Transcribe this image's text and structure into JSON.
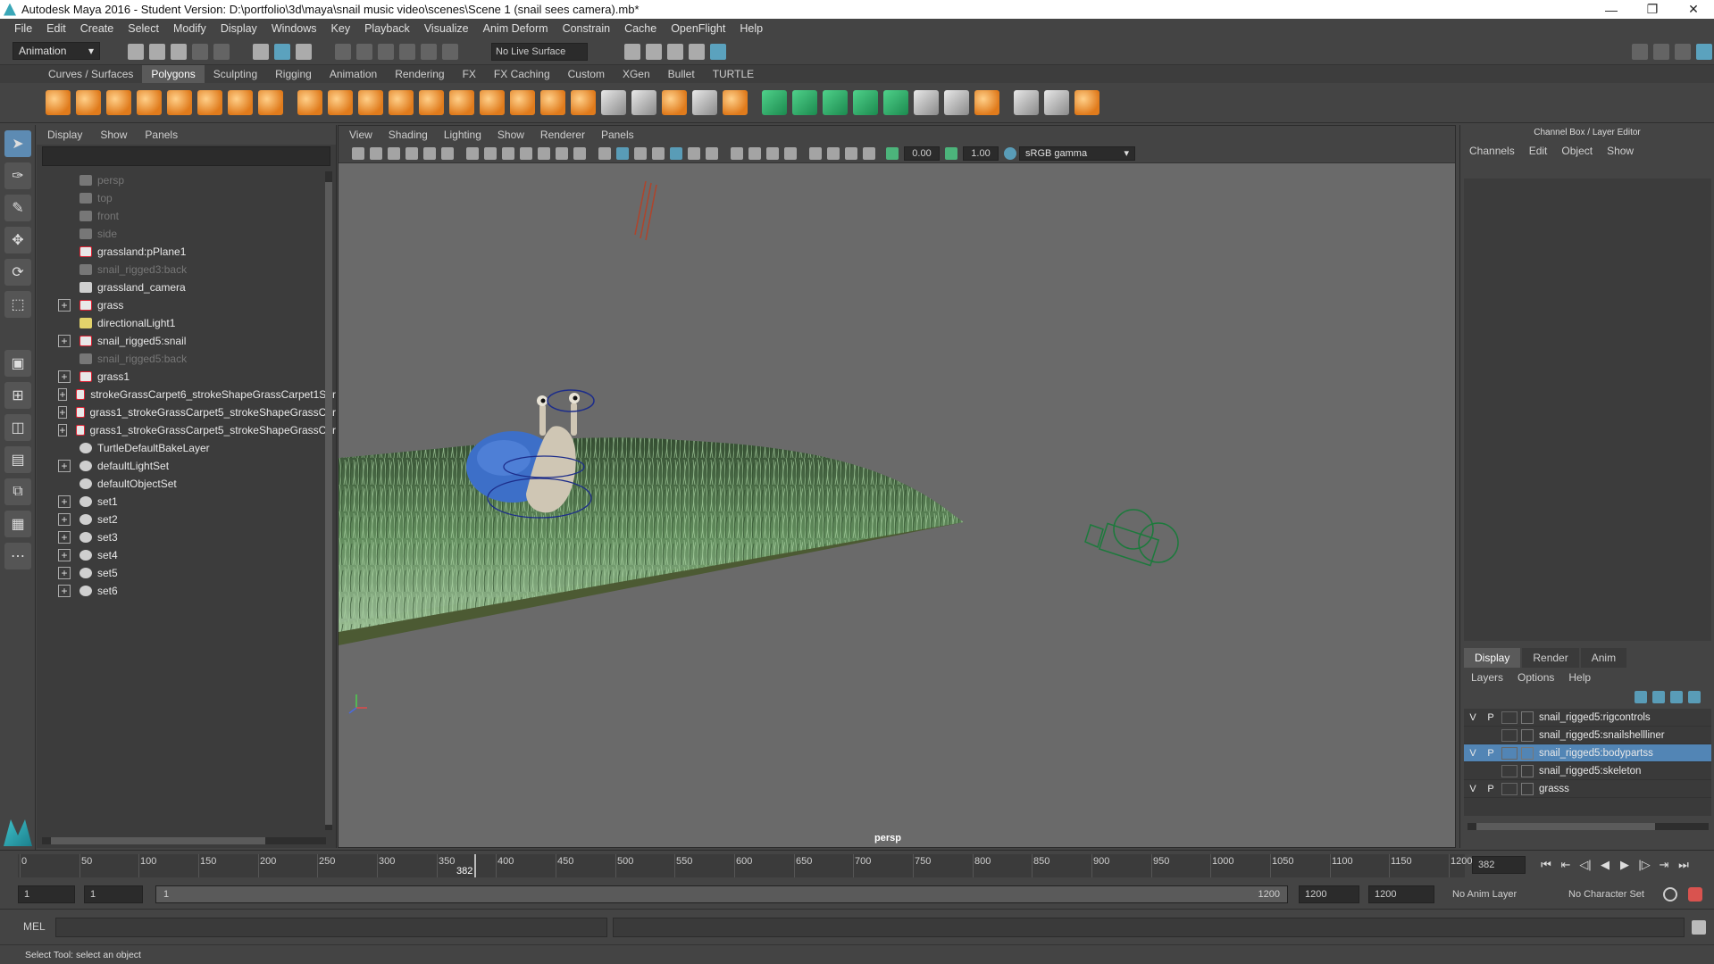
{
  "window": {
    "title": "Autodesk Maya 2016 - Student Version: D:\\portfolio\\3d\\maya\\snail music video\\scenes\\Scene 1 (snail sees camera).mb*",
    "min": "—",
    "max": "❐",
    "close": "✕"
  },
  "menubar": [
    "File",
    "Edit",
    "Create",
    "Select",
    "Modify",
    "Display",
    "Windows",
    "Key",
    "Playback",
    "Visualize",
    "Anim Deform",
    "Constrain",
    "Cache",
    "OpenFlight",
    "Help"
  ],
  "statusline": {
    "menuset": "Animation",
    "live_surface": "No Live Surface"
  },
  "shelf": {
    "tabs": [
      "Curves / Surfaces",
      "Polygons",
      "Sculpting",
      "Rigging",
      "Animation",
      "Rendering",
      "FX",
      "FX Caching",
      "Custom",
      "XGen",
      "Bullet",
      "TURTLE"
    ],
    "active_tab": "Polygons"
  },
  "outliner": {
    "menu": [
      "Display",
      "Show",
      "Panels"
    ],
    "items": [
      {
        "label": "persp",
        "icon": "camera-icon",
        "dim": true,
        "expand": false
      },
      {
        "label": "top",
        "icon": "camera-icon",
        "dim": true,
        "expand": false
      },
      {
        "label": "front",
        "icon": "camera-icon",
        "dim": true,
        "expand": false
      },
      {
        "label": "side",
        "icon": "camera-icon",
        "dim": true,
        "expand": false
      },
      {
        "label": "grassland:pPlane1",
        "icon": "mesh-icon",
        "dim": false,
        "expand": false
      },
      {
        "label": "snail_rigged3:back",
        "icon": "camera-icon",
        "dim": true,
        "expand": false
      },
      {
        "label": "grassland_camera",
        "icon": "camera-icon",
        "dim": false,
        "expand": false
      },
      {
        "label": "grass",
        "icon": "mesh-icon",
        "dim": false,
        "expand": true
      },
      {
        "label": "directionalLight1",
        "icon": "light-icon",
        "dim": false,
        "expand": false
      },
      {
        "label": "snail_rigged5:snail",
        "icon": "mesh-icon",
        "dim": false,
        "expand": true
      },
      {
        "label": "snail_rigged5:back",
        "icon": "camera-icon",
        "dim": true,
        "expand": false
      },
      {
        "label": "grass1",
        "icon": "mesh-icon",
        "dim": false,
        "expand": true
      },
      {
        "label": "strokeGrassCarpet6_strokeShapeGrassCarpet1Sur",
        "icon": "mesh-icon",
        "dim": false,
        "expand": true
      },
      {
        "label": "grass1_strokeGrassCarpet5_strokeShapeGrassCar",
        "icon": "mesh-icon",
        "dim": false,
        "expand": true
      },
      {
        "label": "grass1_strokeGrassCarpet5_strokeShapeGrassCar",
        "icon": "mesh-icon",
        "dim": false,
        "expand": true
      },
      {
        "label": "TurtleDefaultBakeLayer",
        "icon": "set-icon",
        "dim": false,
        "expand": false
      },
      {
        "label": "defaultLightSet",
        "icon": "set-icon",
        "dim": false,
        "expand": true
      },
      {
        "label": "defaultObjectSet",
        "icon": "set-icon",
        "dim": false,
        "expand": false
      },
      {
        "label": "set1",
        "icon": "set-icon",
        "dim": false,
        "expand": true
      },
      {
        "label": "set2",
        "icon": "set-icon",
        "dim": false,
        "expand": true
      },
      {
        "label": "set3",
        "icon": "set-icon",
        "dim": false,
        "expand": true
      },
      {
        "label": "set4",
        "icon": "set-icon",
        "dim": false,
        "expand": true
      },
      {
        "label": "set5",
        "icon": "set-icon",
        "dim": false,
        "expand": true
      },
      {
        "label": "set6",
        "icon": "set-icon",
        "dim": false,
        "expand": true
      }
    ]
  },
  "viewport": {
    "menu": [
      "View",
      "Shading",
      "Lighting",
      "Show",
      "Renderer",
      "Panels"
    ],
    "exposure": "0.00",
    "gamma": "1.00",
    "colorspace": "sRGB gamma",
    "camera_label": "persp"
  },
  "channelbox": {
    "title": "Channel Box / Layer Editor",
    "menu": [
      "Channels",
      "Edit",
      "Object",
      "Show"
    ],
    "layer_tabs": [
      "Display",
      "Render",
      "Anim"
    ],
    "active_layer_tab": "Display",
    "layer_menu": [
      "Layers",
      "Options",
      "Help"
    ],
    "layers": [
      {
        "v": "V",
        "p": "P",
        "name": "snail_rigged5:rigcontrols",
        "selected": false
      },
      {
        "v": "",
        "p": "",
        "name": "snail_rigged5:snailshellliner",
        "selected": false
      },
      {
        "v": "V",
        "p": "P",
        "name": "snail_rigged5:bodypartss",
        "selected": true
      },
      {
        "v": "",
        "p": "",
        "name": "snail_rigged5:skeleton",
        "selected": false
      },
      {
        "v": "V",
        "p": "P",
        "name": "grasss",
        "selected": false
      }
    ]
  },
  "timeslider": {
    "ticks": [
      0,
      50,
      100,
      150,
      200,
      250,
      300,
      350,
      400,
      450,
      500,
      550,
      600,
      650,
      700,
      750,
      800,
      850,
      900,
      950,
      1000,
      1050,
      1100,
      1150,
      1200
    ],
    "range_end": 1200,
    "current_frame": "382",
    "current_frame_value": 382,
    "frame_field": "382"
  },
  "rangeslider": {
    "start": "1",
    "anim_start": "1",
    "bar_start": "1",
    "bar_end": "1200",
    "anim_end": "1200",
    "end": "1200",
    "anim_layer": "No Anim Layer",
    "char_set": "No Character Set"
  },
  "cmdline": {
    "label": "MEL"
  },
  "helpline": {
    "text": "Select Tool: select an object"
  }
}
